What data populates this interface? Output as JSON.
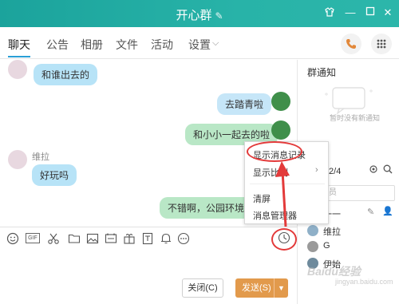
{
  "window": {
    "title": "开心群",
    "edit_icon": "pencil-icon"
  },
  "tabs": [
    {
      "label": "聊天"
    },
    {
      "label": "公告"
    },
    {
      "label": "相册"
    },
    {
      "label": "文件"
    },
    {
      "label": "活动"
    },
    {
      "label": "设置"
    }
  ],
  "chat": {
    "messages": [
      {
        "text": "和谁出去的"
      },
      {
        "text": "去踏青啦"
      },
      {
        "text": "和小小一起去的啦"
      },
      {
        "sender": "维拉",
        "text": "好玩吗"
      },
      {
        "text": "不错啊，公园环境超棒"
      }
    ]
  },
  "context_menu": {
    "items": [
      {
        "label": "显示消息记录"
      },
      {
        "label": "显示比例"
      },
      {
        "label": "清屏"
      },
      {
        "label": "消息管理器"
      }
    ]
  },
  "buttons": {
    "close": "关闭(C)",
    "send": "发送(S)"
  },
  "right_panel": {
    "title": "群通知",
    "empty_text": "暂时没有新通知",
    "members_label": "成员 2/4",
    "search_placeholder": "群成员",
    "members": [
      {
        "name": "一一"
      },
      {
        "name": "维拉"
      },
      {
        "name": "G"
      },
      {
        "name": "伊始"
      }
    ]
  },
  "watermark": {
    "brand": "Baidu经验",
    "url": "jingyan.baidu.com"
  },
  "colors": {
    "titlebar": "#1ba39c",
    "accent_blue": "#2a9fd6",
    "send_button": "#e29a4c",
    "annotation_red": "#e33a3a"
  }
}
